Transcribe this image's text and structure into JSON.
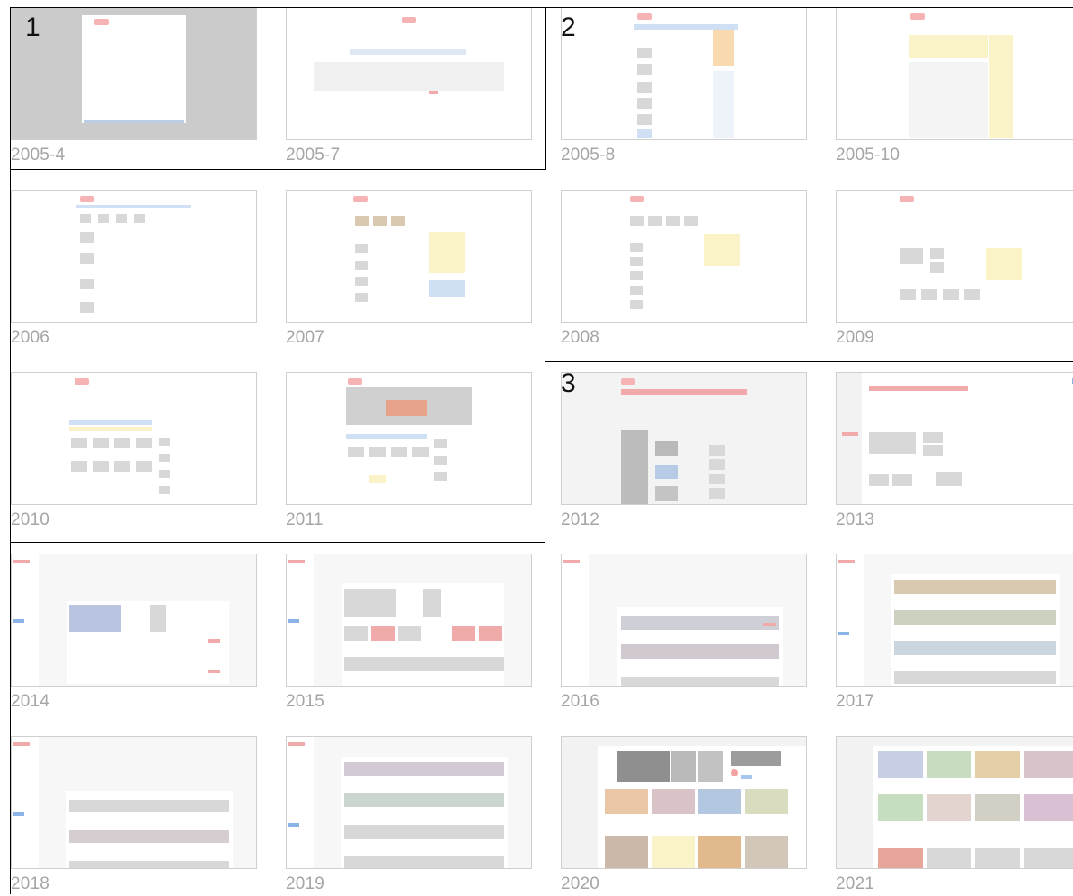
{
  "groups": [
    {
      "number": "1"
    },
    {
      "number": "2"
    },
    {
      "number": "3"
    }
  ],
  "captions": [
    "2005-4",
    "2005-7",
    "2005-8",
    "2005-10",
    "2006",
    "2007",
    "2008",
    "2009",
    "2010",
    "2011",
    "2012",
    "2013",
    "2014",
    "2015",
    "2016",
    "2017",
    "2018",
    "2019",
    "2020",
    "2021"
  ]
}
